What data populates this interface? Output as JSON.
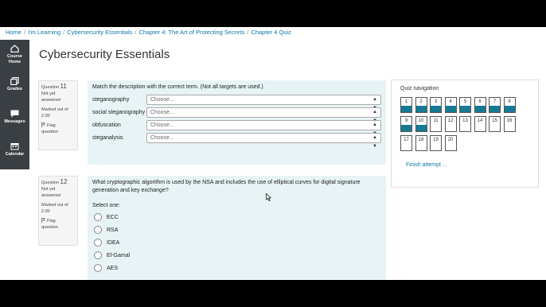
{
  "breadcrumb": [
    "Home",
    "I'm Learning",
    "Cybersecurity Essentials",
    "Chapter 4: The Art of Protecting Secrets",
    "Chapter 4 Quiz"
  ],
  "sidebar": {
    "items": [
      {
        "label1": "Course",
        "label2": "Home",
        "icon": "home-icon"
      },
      {
        "label1": "Grades",
        "label2": "",
        "icon": "grades-icon"
      },
      {
        "label1": "Messages",
        "label2": "",
        "icon": "messages-icon"
      },
      {
        "label1": "Calendar",
        "label2": "",
        "icon": "calendar-icon"
      }
    ]
  },
  "page_title": "Cybersecurity Essentials",
  "questions": [
    {
      "label": "Question",
      "number": "11",
      "status1": "Not yet",
      "status2": "answered",
      "marked1": "Marked out of",
      "marked2": "2.00",
      "flag1": "Flag",
      "flag2": "question",
      "text": "Match the description with the correct term. (Not all targets are used.)",
      "terms": [
        "steganography",
        "social steganography",
        "obfuscation",
        "steganalysis"
      ],
      "choose_label": "Choose..."
    },
    {
      "label": "Question",
      "number": "12",
      "status1": "Not yet",
      "status2": "answered",
      "marked1": "Marked out of",
      "marked2": "2.00",
      "flag1": "Flag",
      "flag2": "question",
      "text": "What cryptographic algorithm is used by the NSA and includes the use of elliptical curves for digital signature generation and key exchange?",
      "select_one": "Select one:",
      "options": [
        "ECC",
        "RSA",
        "IDEA",
        "El-Gamal",
        "AES"
      ]
    }
  ],
  "quiz_nav": {
    "title": "Quiz navigation",
    "buttons": [
      {
        "n": "1",
        "answered": true
      },
      {
        "n": "2",
        "answered": true
      },
      {
        "n": "3",
        "answered": true
      },
      {
        "n": "4",
        "answered": true
      },
      {
        "n": "5",
        "answered": true
      },
      {
        "n": "6",
        "answered": true
      },
      {
        "n": "7",
        "answered": true
      },
      {
        "n": "8",
        "answered": true
      },
      {
        "n": "9",
        "answered": true
      },
      {
        "n": "10",
        "answered": true
      },
      {
        "n": "11",
        "answered": false
      },
      {
        "n": "12",
        "answered": false
      },
      {
        "n": "13",
        "answered": false
      },
      {
        "n": "14",
        "answered": false
      },
      {
        "n": "15",
        "answered": false
      },
      {
        "n": "16",
        "answered": false
      },
      {
        "n": "17",
        "answered": false
      },
      {
        "n": "18",
        "answered": false
      },
      {
        "n": "19",
        "answered": false
      },
      {
        "n": "20",
        "answered": false
      }
    ],
    "finish_label": "Finish attempt ..."
  },
  "colors": {
    "accent": "#167a94",
    "link": "#1177aa",
    "sidebar": "#3a3f44",
    "question_bg": "#e7f3f5"
  }
}
